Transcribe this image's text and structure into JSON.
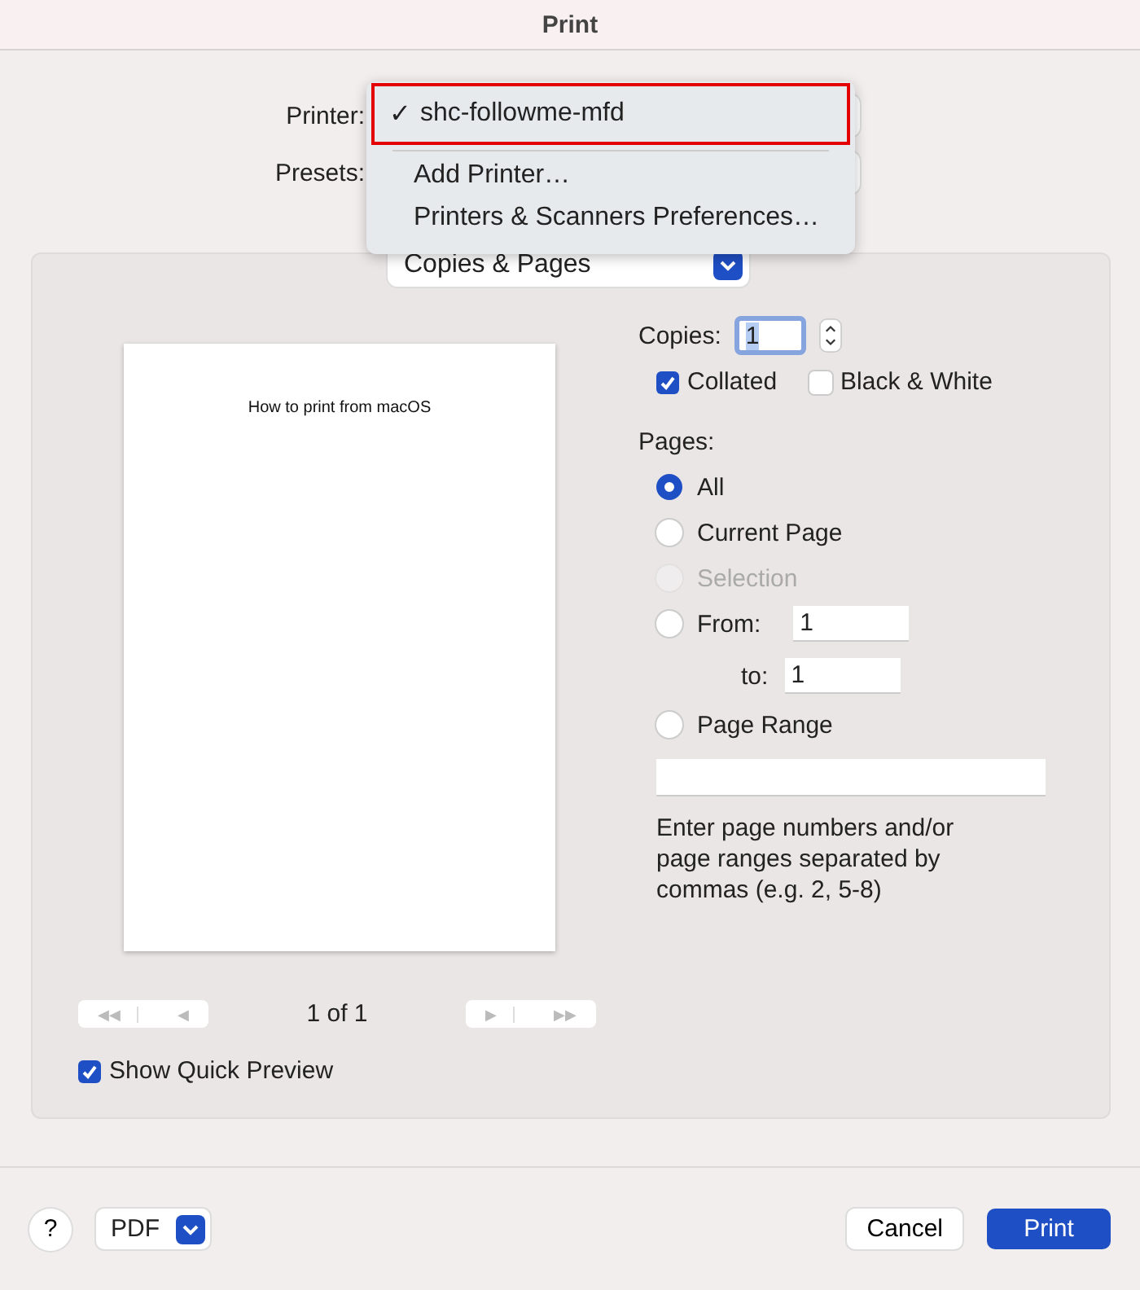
{
  "window": {
    "title": "Print"
  },
  "printer": {
    "label": "Printer:"
  },
  "presets": {
    "label": "Presets:"
  },
  "printer_menu": {
    "items": [
      {
        "label": "shc-followme-mfd",
        "mark": "✓",
        "selected": true
      }
    ],
    "actions": [
      "Add Printer…",
      "Printers & Scanners Preferences…"
    ]
  },
  "section_popup": {
    "label": "Copies & Pages"
  },
  "preview": {
    "page_text": "How to print from macOS",
    "page_indicator": "1 of 1",
    "nav_left": [
      "◀◀",
      "◀"
    ],
    "nav_right": [
      "▶",
      "▶▶"
    ],
    "show_quick_preview": {
      "label": "Show Quick Preview",
      "checked": true
    }
  },
  "copies": {
    "label": "Copies:",
    "value": "1"
  },
  "print_options": [
    {
      "label": "Collated",
      "checked": true
    },
    {
      "label": "Black & White",
      "checked": false
    }
  ],
  "pages": {
    "label": "Pages:",
    "options": [
      {
        "kind": "plain",
        "label": "All",
        "selected": true,
        "disabled": false
      },
      {
        "kind": "plain",
        "label": "Current Page",
        "selected": false,
        "disabled": false
      },
      {
        "kind": "plain",
        "label": "Selection",
        "selected": false,
        "disabled": true
      },
      {
        "kind": "from_to",
        "label": "From:",
        "selected": false,
        "disabled": false,
        "value": "1",
        "to_label": "to:",
        "to_value": "1"
      },
      {
        "kind": "range",
        "label": "Page Range",
        "selected": false,
        "disabled": false,
        "hint": "Enter page numbers and/or page ranges separated by commas (e.g. 2, 5-8)"
      }
    ]
  },
  "footer": {
    "help": "?",
    "pdf": "PDF",
    "buttons": [
      {
        "label": "Cancel",
        "kind": "normal"
      },
      {
        "label": "Print",
        "kind": "default"
      }
    ]
  }
}
